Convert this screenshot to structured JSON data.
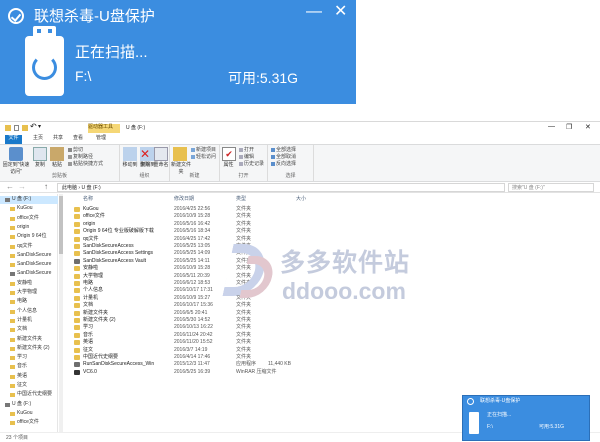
{
  "popup": {
    "title": "联想杀毒-U盘保护",
    "status": "正在扫描...",
    "drive": "F:\\",
    "free": "可用:5.31G",
    "minimize": "—",
    "close": "✕",
    "accent": "#3b8de0"
  },
  "explorer": {
    "ribbon_context": "驱动器工具",
    "window_title": "U 盘 (F:)",
    "quick_undo": "↶",
    "quick_dd": "▾",
    "win_min": "—",
    "win_max": "❐",
    "win_close": "✕",
    "tabs": [
      "文件",
      "主页",
      "共享",
      "查看",
      "管理"
    ],
    "ribbon": {
      "pin_label": "固定到\"快速访问\"",
      "copy_label": "复制",
      "paste_label": "粘贴",
      "cut": "剪切",
      "copy_path": "复制路径",
      "paste_shortcut": "粘贴快捷方式",
      "clipboard_group": "剪贴板",
      "move_to": "移动到",
      "copy_to": "复制到",
      "delete": "删除",
      "rename": "重命名",
      "organize_group": "组织",
      "new_folder": "新建文件夹",
      "new_item": "新建项目",
      "easy_access": "轻松访问",
      "new_group": "新建",
      "properties": "属性",
      "open": "打开",
      "edit": "编辑",
      "history": "历史记录",
      "open_group": "打开",
      "select_all": "全部选择",
      "select_none": "全部取消",
      "invert": "反向选择",
      "select_group": "选择"
    },
    "address": {
      "back": "←",
      "forward": "→",
      "up": "↑",
      "path": "此电脑 › U 盘 (F:)",
      "search_placeholder": "搜索\"U 盘 (F:)\""
    },
    "nav_items": [
      {
        "label": "U 盘 (F:)",
        "kind": "drive"
      },
      {
        "label": "KuGou",
        "kind": "folder"
      },
      {
        "label": "office文件",
        "kind": "folder"
      },
      {
        "label": "origin",
        "kind": "folder"
      },
      {
        "label": "Origin 9 64位",
        "kind": "folder"
      },
      {
        "label": "qq文件",
        "kind": "folder"
      },
      {
        "label": "SanDiskSecure",
        "kind": "folder"
      },
      {
        "label": "SanDiskSecure",
        "kind": "folder"
      },
      {
        "label": "SanDiskSecure",
        "kind": "app"
      },
      {
        "label": "安静啦",
        "kind": "folder"
      },
      {
        "label": "大学物理",
        "kind": "folder"
      },
      {
        "label": "电路",
        "kind": "folder"
      },
      {
        "label": "个人信息",
        "kind": "folder"
      },
      {
        "label": "计量机",
        "kind": "folder"
      },
      {
        "label": "文档",
        "kind": "folder"
      },
      {
        "label": "新建文件夹",
        "kind": "folder"
      },
      {
        "label": "新建文件夹 (2)",
        "kind": "folder"
      },
      {
        "label": "学习",
        "kind": "folder"
      },
      {
        "label": "音乐",
        "kind": "folder"
      },
      {
        "label": "英语",
        "kind": "folder"
      },
      {
        "label": "征文",
        "kind": "folder"
      },
      {
        "label": "中国近代史纲要",
        "kind": "folder"
      },
      {
        "label": "U 盘 (F:)",
        "kind": "drive"
      },
      {
        "label": "KuGou",
        "kind": "folder"
      },
      {
        "label": "office文件",
        "kind": "folder"
      }
    ],
    "columns": {
      "name": "名称",
      "date": "修改日期",
      "type": "类型",
      "size": "大小"
    },
    "files": [
      {
        "name": "KuGou",
        "date": "2016/4/25 22:56",
        "type": "文件夹",
        "size": "",
        "kind": "folder"
      },
      {
        "name": "office文件",
        "date": "2016/10/9 15:28",
        "type": "文件夹",
        "size": "",
        "kind": "folder"
      },
      {
        "name": "origin",
        "date": "2016/5/16 16:42",
        "type": "文件夹",
        "size": "",
        "kind": "folder"
      },
      {
        "name": "Origin 9 64位 专业版破解版下载",
        "date": "2016/5/16 18:34",
        "type": "文件夹",
        "size": "",
        "kind": "folder"
      },
      {
        "name": "qq文件",
        "date": "2016/4/25 17:42",
        "type": "文件夹",
        "size": "",
        "kind": "folder"
      },
      {
        "name": "SanDiskSecureAccess",
        "date": "2016/5/25 13:05",
        "type": "文件夹",
        "size": "",
        "kind": "folder"
      },
      {
        "name": "SanDiskSecureAccess Settings",
        "date": "2016/5/25 14:09",
        "type": "文件夹",
        "size": "",
        "kind": "folder"
      },
      {
        "name": "SanDiskSecureAccess Vault",
        "date": "2016/5/25 14:11",
        "type": "文件夹",
        "size": "",
        "kind": "app"
      },
      {
        "name": "安静啦",
        "date": "2016/10/9 15:28",
        "type": "文件夹",
        "size": "",
        "kind": "folder"
      },
      {
        "name": "大学物理",
        "date": "2016/5/11 20:39",
        "type": "文件夹",
        "size": "",
        "kind": "folder"
      },
      {
        "name": "电路",
        "date": "2016/6/12 18:53",
        "type": "文件夹",
        "size": "",
        "kind": "folder"
      },
      {
        "name": "个人信息",
        "date": "2016/10/17 17:31",
        "type": "文件夹",
        "size": "",
        "kind": "folder"
      },
      {
        "name": "计量机",
        "date": "2016/10/9 15:27",
        "type": "文件夹",
        "size": "",
        "kind": "folder"
      },
      {
        "name": "文档",
        "date": "2016/10/17 15:36",
        "type": "文件夹",
        "size": "",
        "kind": "folder"
      },
      {
        "name": "新建文件夹",
        "date": "2016/6/5 20:41",
        "type": "文件夹",
        "size": "",
        "kind": "folder"
      },
      {
        "name": "新建文件夹 (2)",
        "date": "2016/5/30 14:52",
        "type": "文件夹",
        "size": "",
        "kind": "folder"
      },
      {
        "name": "学习",
        "date": "2016/10/13 16:22",
        "type": "文件夹",
        "size": "",
        "kind": "folder"
      },
      {
        "name": "音乐",
        "date": "2016/11/24 20:42",
        "type": "文件夹",
        "size": "",
        "kind": "folder"
      },
      {
        "name": "英语",
        "date": "2016/11/20 15:52",
        "type": "文件夹",
        "size": "",
        "kind": "folder"
      },
      {
        "name": "征文",
        "date": "2016/3/7 14:19",
        "type": "文件夹",
        "size": "",
        "kind": "folder"
      },
      {
        "name": "中国近代史纲要",
        "date": "2016/4/14 17:46",
        "type": "文件夹",
        "size": "",
        "kind": "folder"
      },
      {
        "name": "RunSanDiskSecureAccess_Win",
        "date": "2015/12/3 11:47",
        "type": "应用程序",
        "size": "11,440 KB",
        "kind": "app"
      },
      {
        "name": "VC6.0",
        "date": "2016/5/25 16:39",
        "type": "WinRAR 压缩文件",
        "size": "",
        "kind": "dark"
      }
    ],
    "status": "23 个项目"
  },
  "watermark": {
    "text": "多多软件站",
    "url": "ddooo.com"
  },
  "mini_popup": {
    "title": "联想杀毒-U盘保护",
    "status": "正在扫描...",
    "drive": "F:\\",
    "free": "可用:5.31G"
  }
}
